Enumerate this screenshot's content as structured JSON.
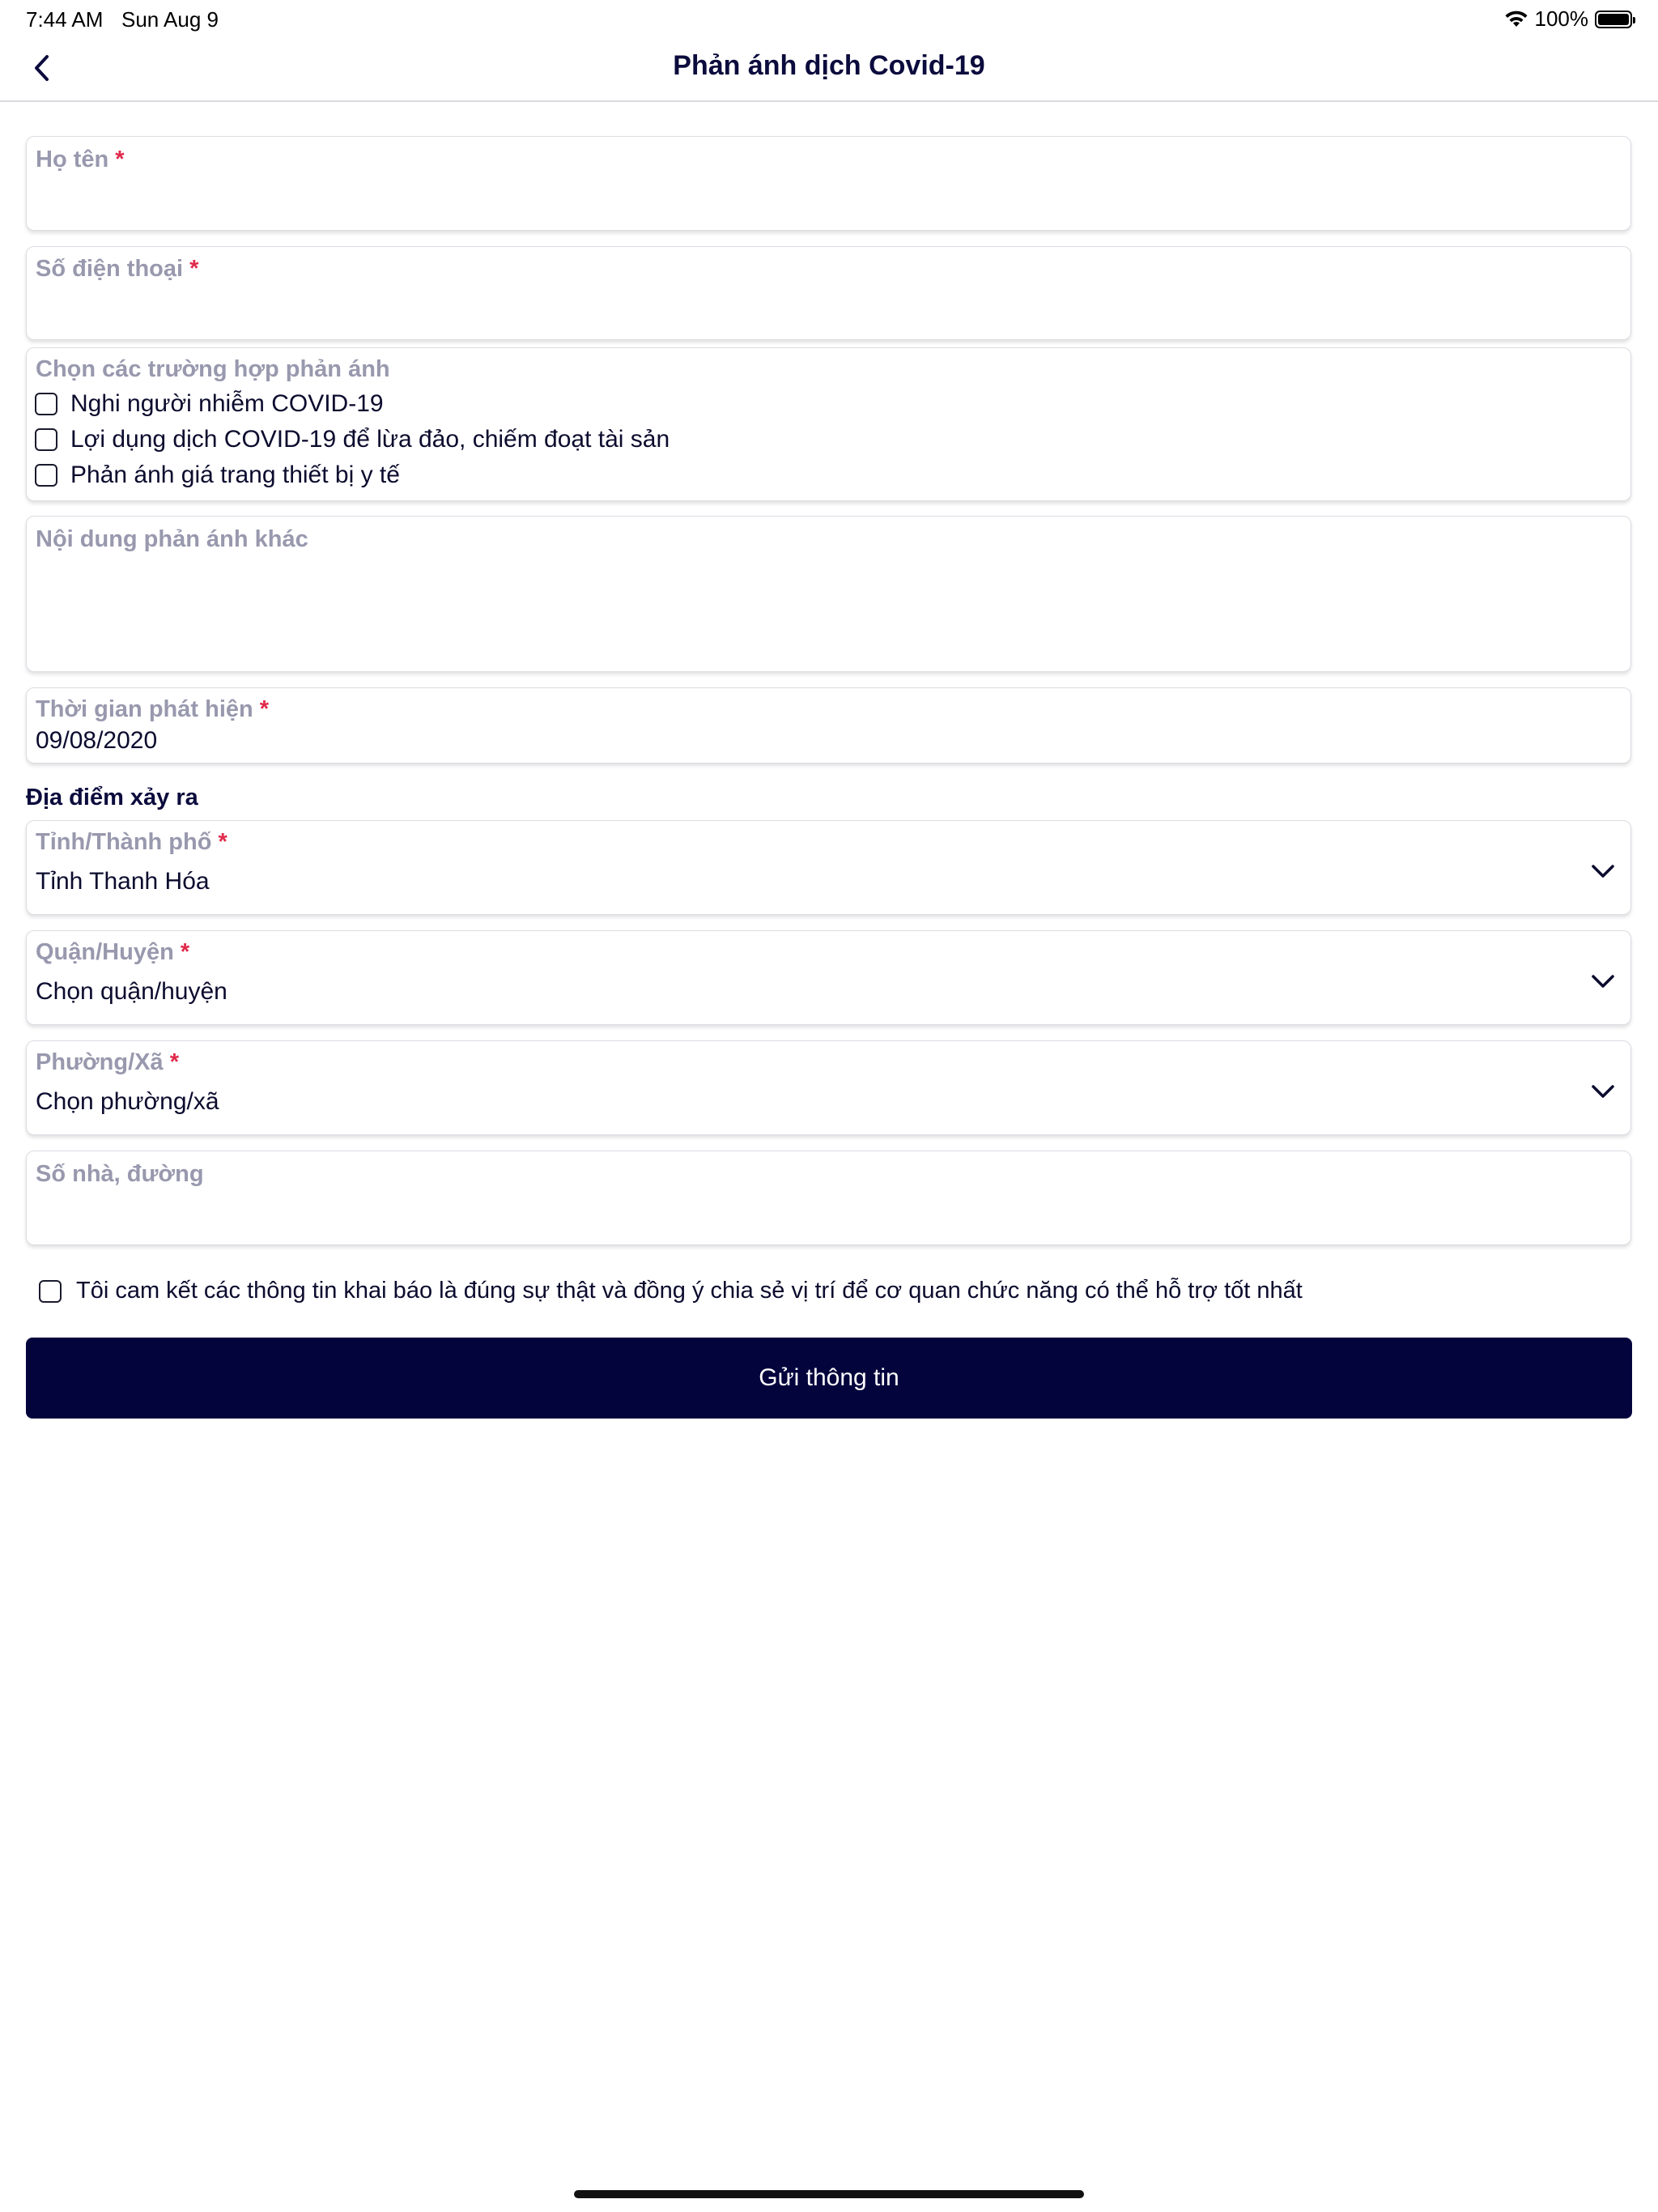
{
  "status_bar": {
    "time": "7:44 AM",
    "date": "Sun Aug 9",
    "battery": "100%"
  },
  "nav": {
    "title": "Phản ánh dịch Covid-19"
  },
  "form": {
    "full_name": {
      "label": "Họ tên",
      "required": "*",
      "value": ""
    },
    "phone": {
      "label": "Số điện thoại",
      "required": "*",
      "value": ""
    },
    "cases": {
      "label": "Chọn các trường hợp phản ánh",
      "options": [
        "Nghi người nhiễm COVID-19",
        "Lợi dụng dịch COVID-19 để lừa đảo, chiếm đoạt tài sản",
        "Phản ánh giá trang thiết bị y tế"
      ]
    },
    "other_content": {
      "label": "Nội dung phản ánh khác",
      "value": ""
    },
    "detect_time": {
      "label": "Thời gian phát hiện",
      "required": "*",
      "value": "09/08/2020"
    },
    "location_section": "Địa điểm xảy ra",
    "province": {
      "label": "Tỉnh/Thành phố",
      "required": "*",
      "value": "Tỉnh Thanh Hóa"
    },
    "district": {
      "label": "Quận/Huyện",
      "required": "*",
      "value": "Chọn quận/huyện"
    },
    "ward": {
      "label": "Phường/Xã",
      "required": "*",
      "value": "Chọn phường/xã"
    },
    "address": {
      "label": "Số nhà, đường",
      "value": ""
    },
    "commitment": "Tôi cam kết các thông tin khai báo là đúng sự thật và đồng ý chia sẻ vị trí để cơ quan chức năng có thể hỗ trợ tốt nhất",
    "submit_label": "Gửi thông tin"
  },
  "colors": {
    "primary": "#04043d",
    "label": "#9898ae",
    "required": "#e0294a",
    "border": "#dcdce3"
  }
}
